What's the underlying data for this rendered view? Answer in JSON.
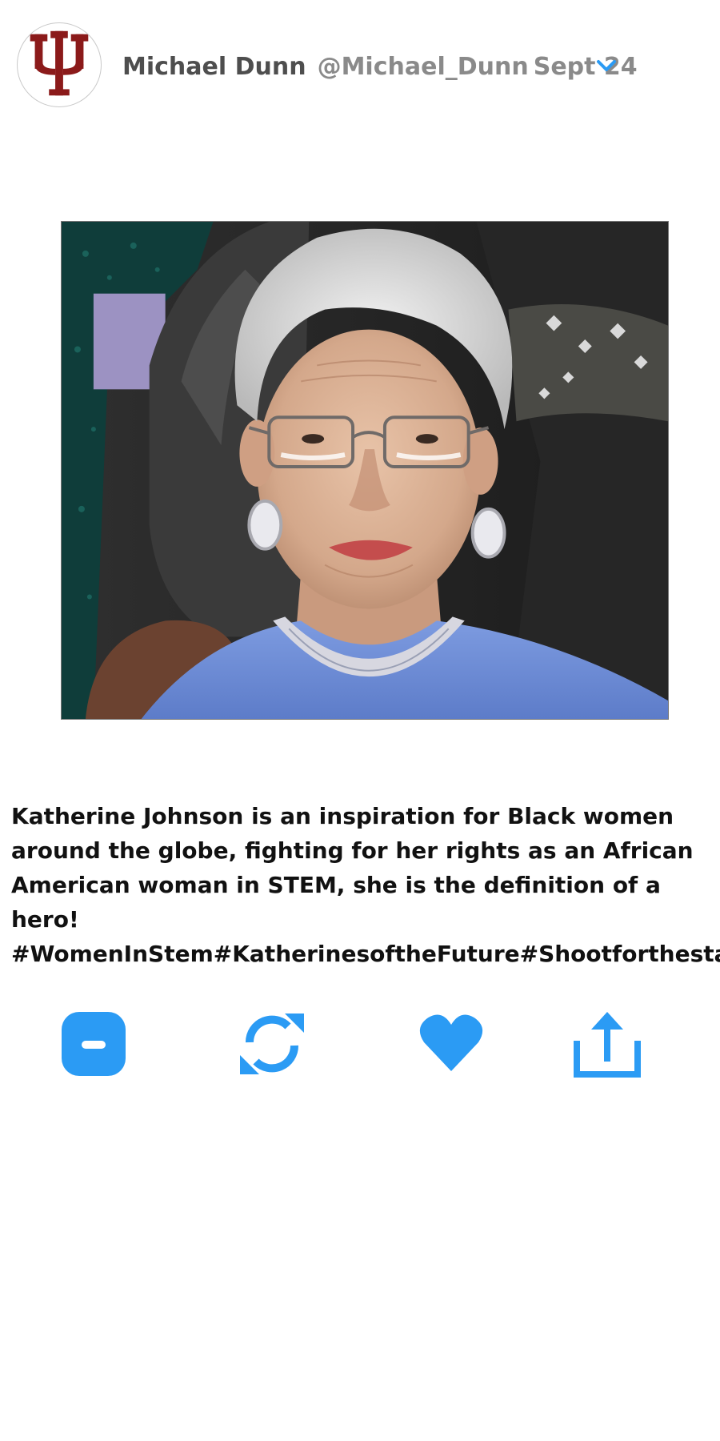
{
  "tweet": {
    "author": {
      "name": "Michael Dunn",
      "handle": "@Michael_Dunn",
      "date": "Sept 24",
      "avatar_icon": "iu-trident-logo-icon"
    },
    "media": {
      "alt": "Katherine Johnson",
      "subject": "elderly woman with white hair, glasses, pearl earrings, blue dress"
    },
    "text": "Katherine Johnson is an inspiration for  Black women\naround the globe, fighting for her rights as an African\nAmerican woman in STEM, she is the definition of a hero!\n#WomenInStem#KatherinesoftheFuture#Shootforthestars",
    "actions": [
      {
        "name": "reply",
        "icon": "reply-icon"
      },
      {
        "name": "retweet",
        "icon": "retweet-icon"
      },
      {
        "name": "like",
        "icon": "heart-icon"
      },
      {
        "name": "share",
        "icon": "share-icon"
      }
    ]
  },
  "colors": {
    "accent": "#2b9bf4",
    "logo": "#8b1a1a",
    "name": "#4e4e4e",
    "handle": "#8a8a8a"
  }
}
